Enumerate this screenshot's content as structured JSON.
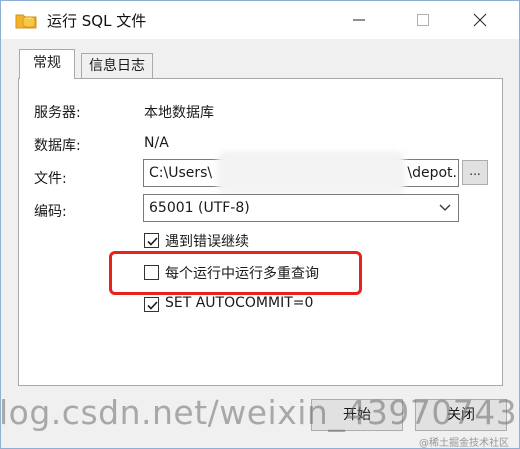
{
  "window": {
    "title": "运行 SQL 文件",
    "icon": "folder-database-icon",
    "controls": [
      "minimize-icon",
      "maximize-icon",
      "close-icon"
    ]
  },
  "tabs": [
    {
      "label": "常规",
      "active": true
    },
    {
      "label": "信息日志",
      "active": false
    }
  ],
  "form": {
    "server_label": "服务器:",
    "server_value": "本地数据库",
    "database_label": "数据库:",
    "database_value": "N/A",
    "file_label": "文件:",
    "file_value_start": "C:\\Users\\",
    "file_value_end": "\\depot.",
    "browse_label": "...",
    "encoding_label": "编码:",
    "encoding_value": "65001 (UTF-8)"
  },
  "options": [
    {
      "label": "遇到错误继续",
      "checked": true
    },
    {
      "label": "每个运行中运行多重查询",
      "checked": false
    },
    {
      "label": "SET AUTOCOMMIT=0",
      "checked": true
    }
  ],
  "buttons": {
    "run": "开始",
    "close": "关闭"
  },
  "watermark": {
    "main": "log.csdn.net/weixin_43970743",
    "corner": "@稀土掘金技术社区"
  },
  "colors": {
    "highlight": "#e8221a",
    "checkbox_check": "#1a1a1a"
  }
}
